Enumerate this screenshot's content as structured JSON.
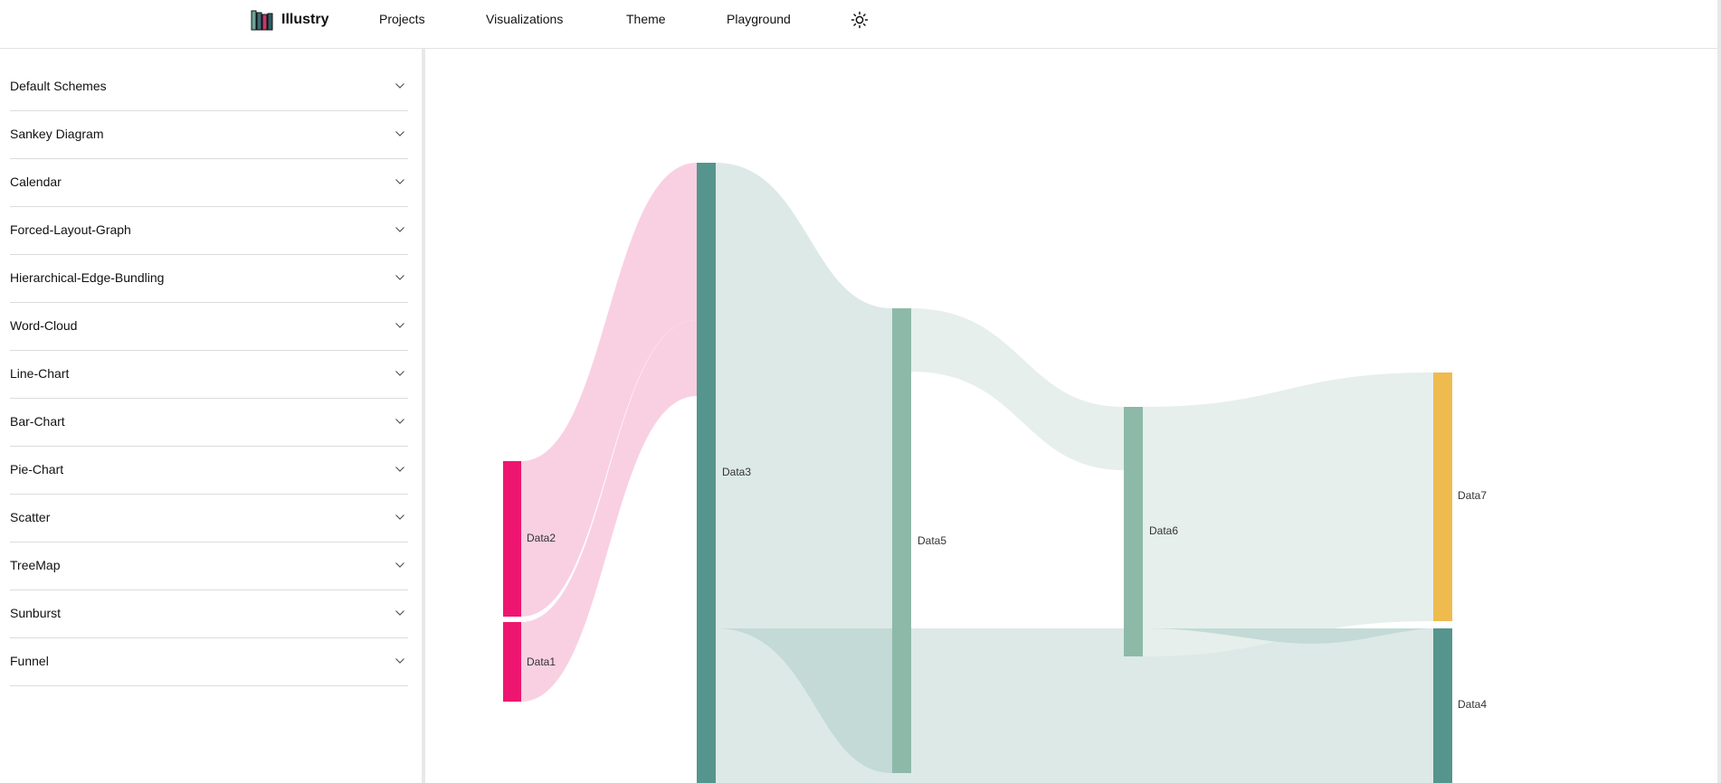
{
  "header": {
    "brand_name": "Illustry",
    "nav": [
      {
        "label": "Projects"
      },
      {
        "label": "Visualizations"
      },
      {
        "label": "Theme"
      },
      {
        "label": "Playground"
      }
    ]
  },
  "sidebar": {
    "items": [
      {
        "label": "Default Schemes"
      },
      {
        "label": "Sankey Diagram"
      },
      {
        "label": "Calendar"
      },
      {
        "label": "Forced-Layout-Graph"
      },
      {
        "label": "Hierarchical-Edge-Bundling"
      },
      {
        "label": "Word-Cloud"
      },
      {
        "label": "Line-Chart"
      },
      {
        "label": "Bar-Chart"
      },
      {
        "label": "Pie-Chart"
      },
      {
        "label": "Scatter"
      },
      {
        "label": "TreeMap"
      },
      {
        "label": "Sunburst"
      },
      {
        "label": "Funnel"
      }
    ]
  },
  "colors": {
    "accent_pink": "#ee1570",
    "teal_dark": "#55958d",
    "teal_light": "#8db9a9",
    "gold": "#efbb4e",
    "link_pink": "#f9d0e2",
    "link_teal": "#dde9e7"
  },
  "sankey": {
    "nodes": [
      {
        "id": "Data1",
        "label": "Data1"
      },
      {
        "id": "Data2",
        "label": "Data2"
      },
      {
        "id": "Data3",
        "label": "Data3"
      },
      {
        "id": "Data4",
        "label": "Data4"
      },
      {
        "id": "Data5",
        "label": "Data5"
      },
      {
        "id": "Data6",
        "label": "Data6"
      },
      {
        "id": "Data7",
        "label": "Data7"
      }
    ]
  }
}
